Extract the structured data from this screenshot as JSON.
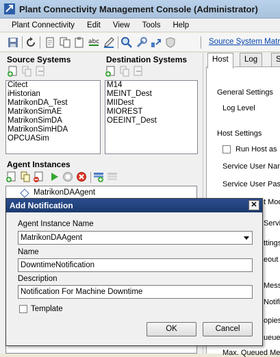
{
  "window": {
    "title": "Plant Connectivity Management Console (Administrator)"
  },
  "menu": [
    "Plant Connectivity",
    "Edit",
    "View",
    "Tools",
    "Help"
  ],
  "toolbar": {
    "link": "Source System Matri"
  },
  "source_systems": {
    "label": "Source Systems",
    "items": [
      "Citect",
      "iHistorian",
      "MatrikonDA_Test",
      "MatrikonSimAE",
      "MatrikonSimDA",
      "MatrikonSimHDA",
      "OPCUASim"
    ]
  },
  "destination_systems": {
    "label": "Destination Systems",
    "items": [
      "M14",
      "MEINT_Dest",
      "MIIDest",
      "MIOREST",
      "OEEINT_Dest"
    ]
  },
  "agent_instances": {
    "label": "Agent Instances",
    "items": [
      "MatrikonDAAgent"
    ]
  },
  "right": {
    "tabs": [
      "Host",
      "Log",
      "S"
    ],
    "general_settings": "General Settings",
    "log_level": "Log Level",
    "host_settings": "Host Settings",
    "run_host": "Run Host as",
    "service_user_name": "Service User Nam",
    "service_user_pass": "Service User Pass",
    "frag_mod": "t Mod",
    "frag_servic": "Servic",
    "frag_ttings": "ttings",
    "frag_eout": "eout",
    "frag_messa": "Messa",
    "frag_notifi": "Notifi",
    "frag_opies": "opies",
    "frag_ueue": "ueue",
    "max_queued": "Max. Queued Mes"
  },
  "dialog": {
    "title": "Add Notification",
    "agent_label": "Agent Instance Name",
    "agent_value": "MatrikonDAAgent",
    "name_label": "Name",
    "name_value": "DowntimeNotification",
    "desc_label": "Description",
    "desc_value": "Notification For Machine Downtime",
    "template_label": "Template",
    "template_checked": false,
    "ok": "OK",
    "cancel": "Cancel"
  }
}
